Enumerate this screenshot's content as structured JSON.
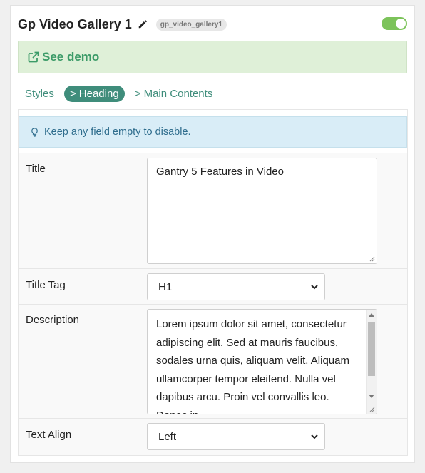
{
  "header": {
    "title": "Gp Video Gallery 1",
    "id_badge": "gp_video_gallery1",
    "enabled": true
  },
  "demo": {
    "label": "See demo"
  },
  "tabs": [
    {
      "label": "Styles",
      "active": false
    },
    {
      "label": "> Heading",
      "active": true
    },
    {
      "label": "> Main Contents",
      "active": false
    }
  ],
  "info": {
    "text": "Keep any field empty to disable."
  },
  "fields": {
    "title": {
      "label": "Title",
      "value": "Gantry 5 Features in Video"
    },
    "title_tag": {
      "label": "Title Tag",
      "value": "H1"
    },
    "description": {
      "label": "Description",
      "value": "Lorem ipsum dolor sit amet, consectetur adipiscing elit. Sed at mauris faucibus, sodales urna quis, aliquam velit. Aliquam ullamcorper tempor eleifend. Nulla vel dapibus arcu. Proin vel convallis leo. Donec in"
    },
    "text_align": {
      "label": "Text Align",
      "value": "Left"
    }
  },
  "colors": {
    "accent": "#3f8d7b",
    "demo_bg": "#dff0d8",
    "info_bg": "#d9edf7",
    "toggle_on": "#7cc35a"
  },
  "icons": {
    "edit": "pencil-icon",
    "demo": "external-link-icon",
    "info": "lightbulb-icon",
    "select": "chevron-down-icon"
  }
}
